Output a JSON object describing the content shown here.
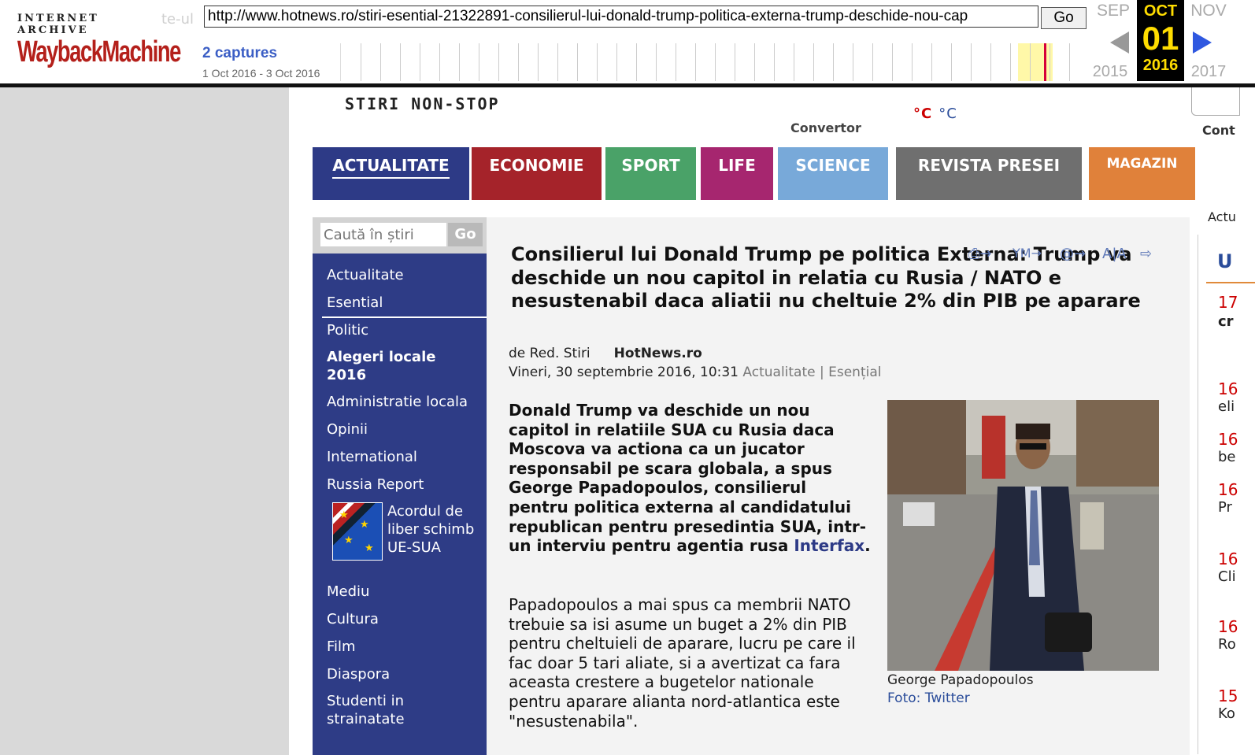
{
  "wayback": {
    "logo_top": "INTERNET ARCHIVE",
    "logo_main": "WaybackMachine",
    "ghost_text": "te-ul",
    "url": "http://www.hotnews.ro/stiri-esential-21322891-consilierul-lui-donald-trump-politica-externa-trump-deschide-nou-cap",
    "go_label": "Go",
    "captures": "2 captures",
    "range": "1 Oct 2016 - 3 Oct 2016",
    "prev_month": "SEP",
    "cur_month": "OCT",
    "next_month": "NOV",
    "cur_day": "01",
    "prev_year": "2015",
    "cur_year": "2016",
    "next_year": "2017",
    "accent": "#ffdd00",
    "capture_color": "#d6003a"
  },
  "header": {
    "tagline": "STIRI NON-STOP",
    "convertor": "Convertor",
    "deg_c1": "°C",
    "deg_c2": "°C",
    "right_label": "Cont"
  },
  "nav": {
    "tabs": [
      {
        "label": "ACTUALITATE",
        "color": "#2d3a86"
      },
      {
        "label": "ECONOMIE",
        "color": "#a5232a"
      },
      {
        "label": "SPORT",
        "color": "#4aa268"
      },
      {
        "label": "LIFE",
        "color": "#a6266f"
      },
      {
        "label": "SCIENCE",
        "color": "#78a9d9"
      },
      {
        "label": "REVISTA PRESEI",
        "color": "#6f6f6f"
      },
      {
        "label": "MAGAZIN",
        "color": "#e0813a"
      }
    ]
  },
  "sidebar": {
    "search_placeholder": "Caută în știri",
    "search_go": "Go",
    "items": [
      "Actualitate",
      "Esential",
      "Politic",
      "Alegeri locale 2016",
      "Administratie locala",
      "Opinii",
      "International",
      "Russia Report",
      "Acordul de liber schimb UE-SUA",
      "Mediu",
      "Cultura",
      "Film",
      "Diaspora",
      "Studenti in strainatate"
    ]
  },
  "article": {
    "title": "Consilierul lui Donald Trump pe politica Externa: Trump va deschide un nou capitol in relatia cu Rusia / NATO e nesustenabil daca aliatii nu cheltuie 2% din PIB pe aparare",
    "author": "de Red. Stiri",
    "source": "HotNews.ro",
    "date": "Vineri, 30 septembrie 2016, 10:31",
    "categories": "Actualitate | Esențial",
    "lead": "Donald Trump va deschide un nou capitol in relatiile SUA cu Rusia daca Moscova va actiona ca un jucator responsabil pe scara globala, a spus George Papadopoulos, consilierul pentru politica externa al candidatului republican pentru presedintia SUA, intr-un interviu pentru agentia rusa",
    "lead_link": "Interfax",
    "paragraph": "Papadopoulos a mai spus ca membrii NATO trebuie sa isi asume un buget a 2% din PIB pentru cheltuieli de aparare, lucru pe care il fac doar 5 tari aliate, si a avertizat ca fara aceasta crestere a bugetelor nationale pentru aparare alianta nord-atlantica este \"nesustenabila\".",
    "photo_caption": "George Papadopoulos",
    "photo_credit": "Foto: Twitter",
    "tools": [
      "print-icon",
      "ym-icon",
      "email-icon",
      "font-size-icon",
      "share-icon"
    ]
  },
  "right": {
    "tab": "Actu",
    "header_letter": "U",
    "items": [
      {
        "num": "17",
        "text": "cr"
      },
      {
        "num": "16",
        "text": "eli"
      },
      {
        "num": "16",
        "text": "be"
      },
      {
        "num": "16",
        "text": "Pr"
      },
      {
        "num": "16",
        "text": "Cli"
      },
      {
        "num": "16",
        "text": "Ro"
      },
      {
        "num": "15",
        "text": "Ko"
      }
    ]
  }
}
